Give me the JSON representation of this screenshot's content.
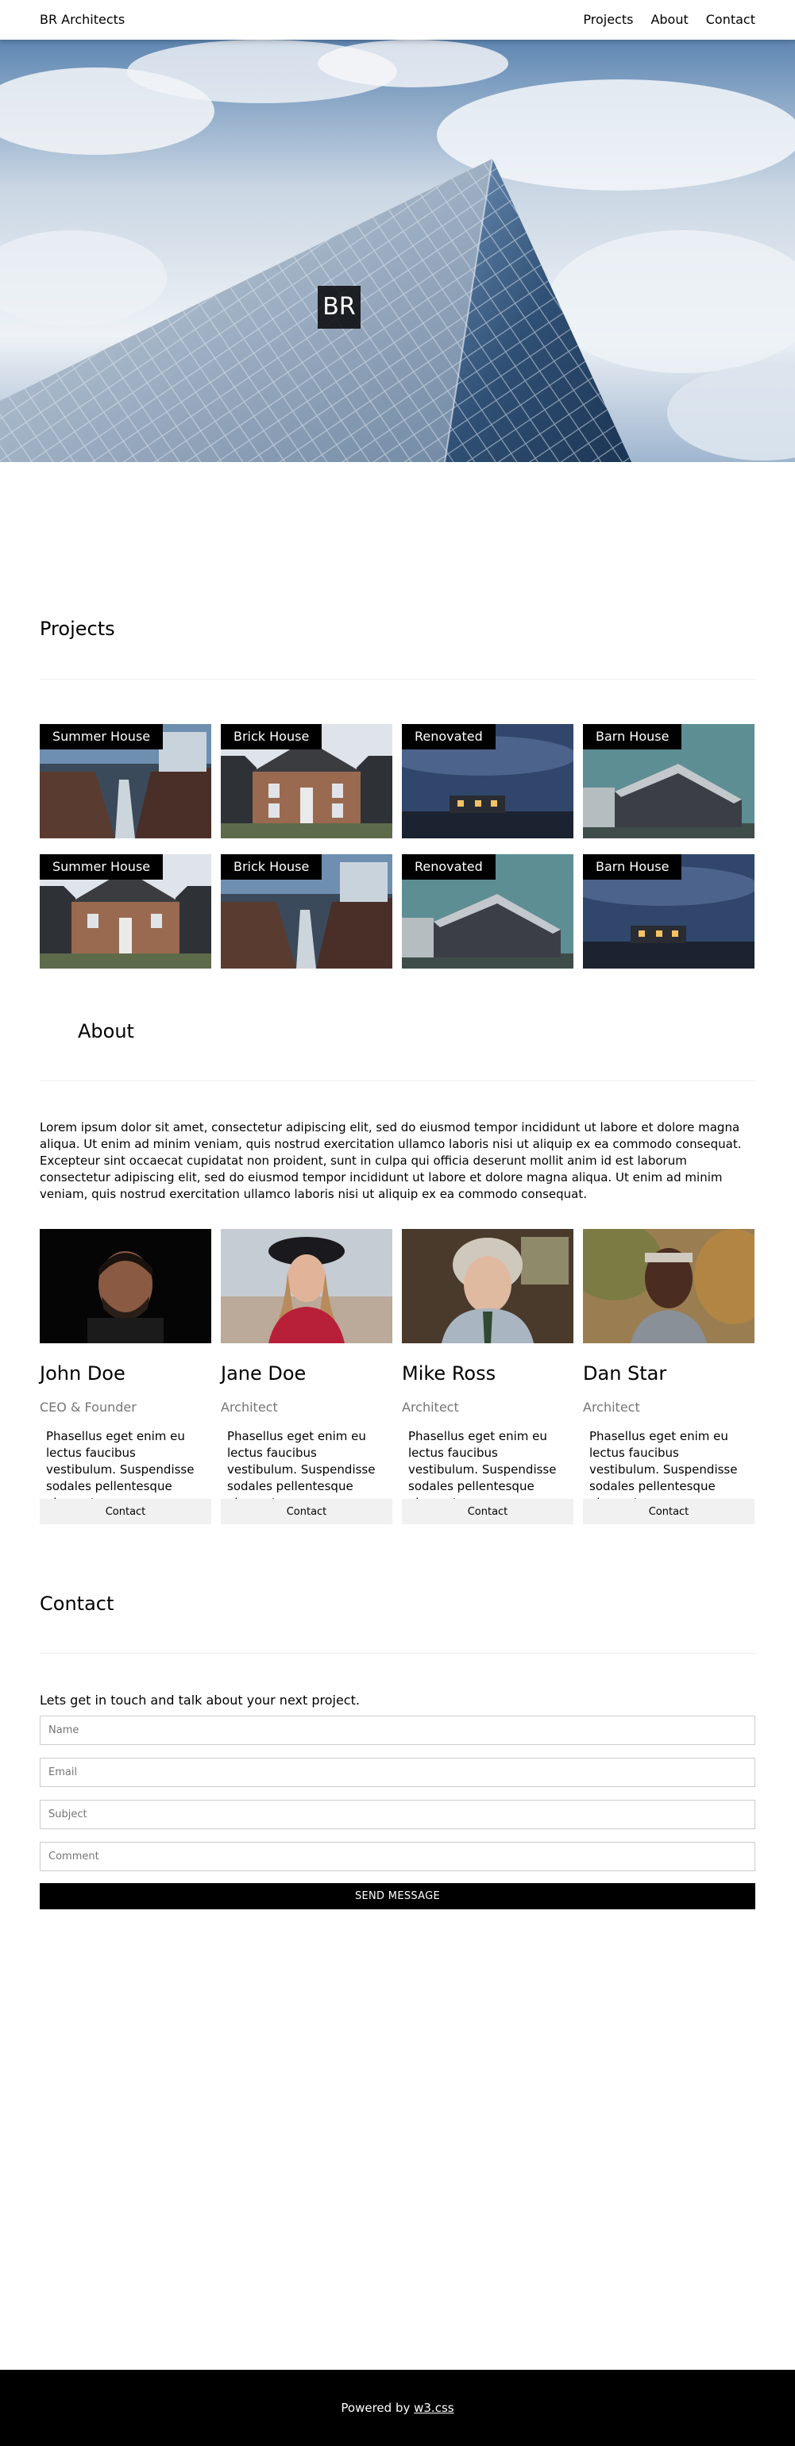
{
  "nav": {
    "brand": "BR Architects",
    "links": [
      "Projects",
      "About",
      "Contact"
    ]
  },
  "hero": {
    "badge": "BR"
  },
  "projects": {
    "title": "Projects",
    "items": [
      {
        "label": "Summer House"
      },
      {
        "label": "Brick House"
      },
      {
        "label": "Renovated"
      },
      {
        "label": "Barn House"
      },
      {
        "label": "Summer House"
      },
      {
        "label": "Brick House"
      },
      {
        "label": "Renovated"
      },
      {
        "label": "Barn House"
      }
    ]
  },
  "about": {
    "title": "About",
    "text": "Lorem ipsum dolor sit amet, consectetur adipiscing elit, sed do eiusmod tempor incididunt ut labore et dolore magna aliqua. Ut enim ad minim veniam, quis nostrud exercitation ullamco laboris nisi ut aliquip ex ea commodo consequat. Excepteur sint occaecat cupidatat non proident, sunt in culpa qui officia deserunt mollit anim id est laborum consectetur adipiscing elit, sed do eiusmod tempor incididunt ut labore et dolore magna aliqua. Ut enim ad minim veniam, quis nostrud exercitation ullamco laboris nisi ut aliquip ex ea commodo consequat.",
    "team": [
      {
        "name": "John Doe",
        "role": "CEO & Founder",
        "bio": "Phasellus eget enim eu lectus faucibus vestibulum. Suspendisse sodales pellentesque elementum.",
        "button": "Contact"
      },
      {
        "name": "Jane Doe",
        "role": "Architect",
        "bio": "Phasellus eget enim eu lectus faucibus vestibulum. Suspendisse sodales pellentesque elementum.",
        "button": "Contact"
      },
      {
        "name": "Mike Ross",
        "role": "Architect",
        "bio": "Phasellus eget enim eu lectus faucibus vestibulum. Suspendisse sodales pellentesque elementum.",
        "button": "Contact"
      },
      {
        "name": "Dan Star",
        "role": "Architect",
        "bio": "Phasellus eget enim eu lectus faucibus vestibulum. Suspendisse sodales pellentesque elementum.",
        "button": "Contact"
      }
    ]
  },
  "contact": {
    "title": "Contact",
    "intro": "Lets get in touch and talk about your next project.",
    "fields": {
      "name": "Name",
      "email": "Email",
      "subject": "Subject",
      "comment": "Comment"
    },
    "submit": "SEND MESSAGE"
  },
  "footer": {
    "prefix": "Powered by ",
    "link": "w3.css"
  }
}
